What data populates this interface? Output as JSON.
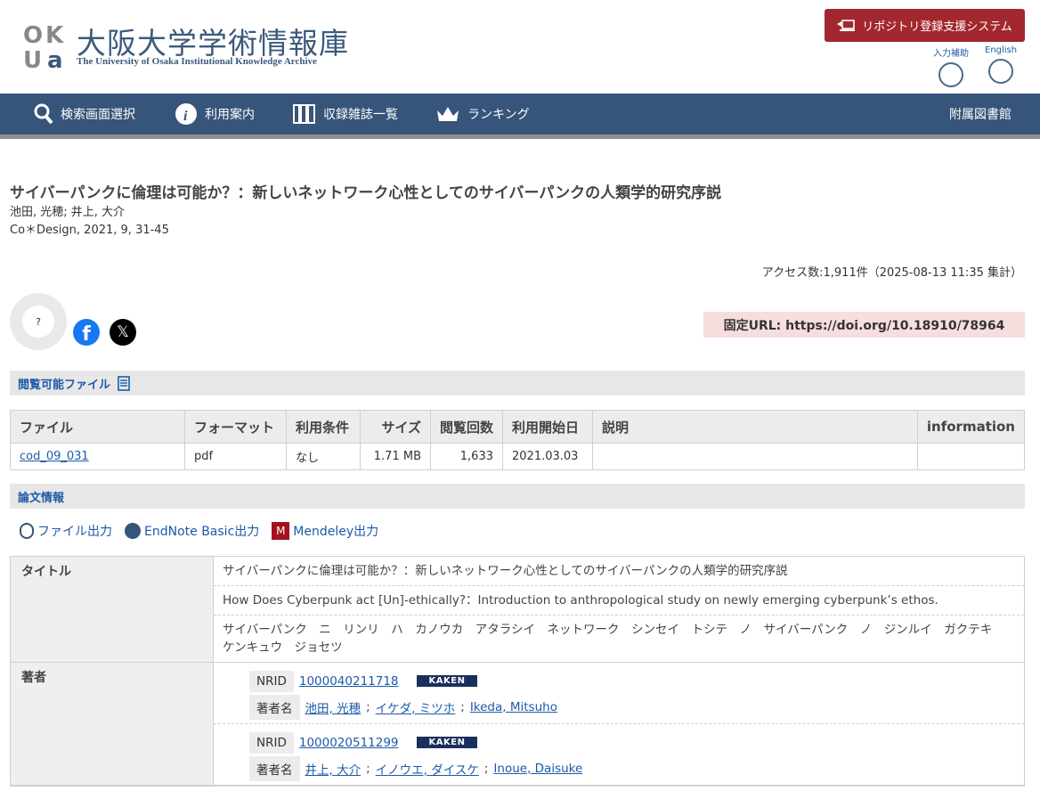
{
  "header": {
    "logo_letters": "OKUa",
    "title": "大阪大学学術情報庫",
    "subtitle": "The University of Osaka Institutional Knowledge Archive",
    "repo_button": "リポジトリ登録支援システム",
    "input_help": "入力補助",
    "english": "English"
  },
  "nav": {
    "search": "検索画面選択",
    "guide": "利用案内",
    "journals": "収録雑誌一覧",
    "ranking": "ランキング",
    "library": "附属図書館"
  },
  "article": {
    "title": "サイバーパンクに倫理は可能か？：新しいネットワーク心性としてのサイバーパンクの人類学的研究序説",
    "authors": "池田, 光穂; 井上, 大介",
    "source": "Co＊Design, 2021, 9, 31-45",
    "access": "アクセス数:1,911件（2025-08-13 11:35 集計）",
    "altmetric": "?",
    "doi": "固定URL: https://doi.org/10.18910/78964"
  },
  "files_section": "閲覧可能ファイル",
  "files": {
    "headers": [
      "ファイル",
      "フォーマット",
      "利用条件",
      "サイズ",
      "閲覧回数",
      "利用開始日",
      "説明",
      "information"
    ],
    "rows": [
      [
        "cod_09_031",
        "pdf",
        "なし",
        "1.71 MB",
        "1,633",
        "2021.03.03",
        "",
        ""
      ]
    ]
  },
  "info_section": "論文情報",
  "exports": {
    "file": "ファイル出力",
    "endnote": "EndNote Basic出力",
    "mendeley": "Mendeley出力"
  },
  "meta": {
    "title_label": "タイトル",
    "titles": [
      "サイバーパンクに倫理は可能か？：新しいネットワーク心性としてのサイバーパンクの人類学的研究序説",
      "How Does Cyberpunk act [Un]-ethically?：Introduction to anthropological study on newly emerging cyberpunk’s ethos.",
      "サイバーパンク　ニ　リンリ　ハ　カノウカ　アタラシイ　ネットワーク　シンセイ　トシテ　ノ　サイバーパンク　ノ　ジンルイ　ガクテキ　ケンキュウ　ジョセツ"
    ],
    "author_label": "著者",
    "nrid_label": "NRID",
    "name_label": "著者名",
    "kaken": "KAKEN",
    "authors": [
      {
        "nrid": "1000040211718",
        "names": [
          "池田, 光穂",
          "イケダ, ミツホ",
          "Ikeda, Mitsuho"
        ]
      },
      {
        "nrid": "1000020511299",
        "names": [
          "井上, 大介",
          "イノウエ, ダイスケ",
          "Inoue, Daisuke"
        ]
      }
    ]
  }
}
